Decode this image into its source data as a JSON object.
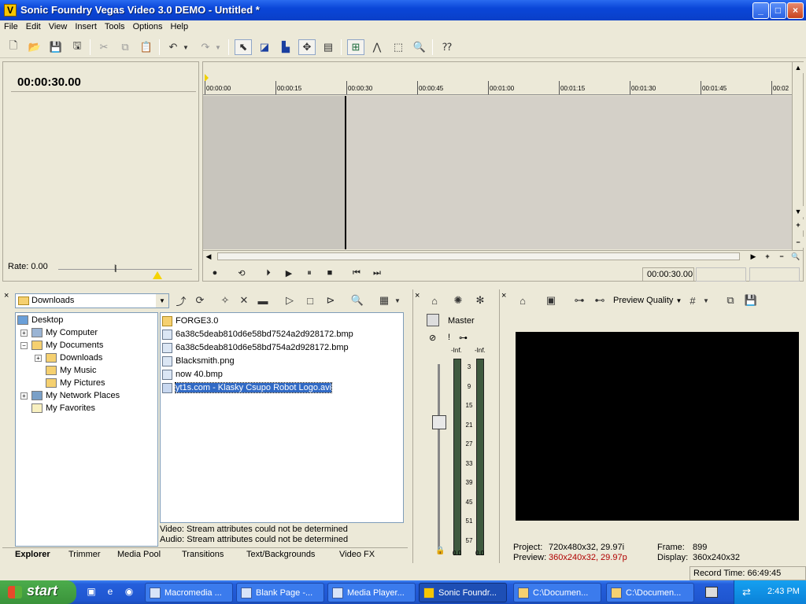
{
  "window": {
    "title": "Sonic Foundry Vegas Video 3.0 DEMO - Untitled *",
    "app_icon": "V",
    "controls": {
      "minimize": "_",
      "maximize": "□",
      "close": "×"
    }
  },
  "menu": [
    "File",
    "Edit",
    "View",
    "Insert",
    "Tools",
    "Options",
    "Help"
  ],
  "timeline": {
    "time_display": "00:00:30.00",
    "rate_label": "Rate: 0.00",
    "ruler_ticks": [
      "00:00:00",
      "00:00:15",
      "00:00:30",
      "00:00:45",
      "00:01:00",
      "00:01:15",
      "00:01:30",
      "00:01:45",
      "00:02"
    ],
    "transport_time": "00:00:30.00"
  },
  "explorer": {
    "current_folder": "Downloads",
    "tree": [
      {
        "label": "Desktop",
        "icon": "desktop-icon",
        "level": 0
      },
      {
        "label": "My Computer",
        "icon": "computer-icon",
        "level": 1,
        "expander": "+"
      },
      {
        "label": "My Documents",
        "icon": "folder-icon",
        "level": 1,
        "expander": "−"
      },
      {
        "label": "Downloads",
        "icon": "folder-icon",
        "level": 2,
        "expander": "+"
      },
      {
        "label": "My Music",
        "icon": "music-folder-icon",
        "level": 2
      },
      {
        "label": "My Pictures",
        "icon": "pictures-folder-icon",
        "level": 2
      },
      {
        "label": "My Network Places",
        "icon": "network-icon",
        "level": 1,
        "expander": "+"
      },
      {
        "label": "My Favorites",
        "icon": "favorites-icon",
        "level": 1
      }
    ],
    "files": [
      {
        "name": "FORGE3.0",
        "icon": "folder-icon"
      },
      {
        "name": "6a38c5deab810d6e58bd7524a2d928172.bmp",
        "icon": "image-file-icon"
      },
      {
        "name": "6a38c5deab810d6e58bd754a2d928172.bmp",
        "icon": "image-file-icon"
      },
      {
        "name": "Blacksmith.png",
        "icon": "image-file-icon"
      },
      {
        "name": "now 40.bmp",
        "icon": "image-file-icon"
      },
      {
        "name": "yt1s.com - Klasky Csupo Robot Logo.avi",
        "icon": "video-file-icon",
        "selected": true
      }
    ],
    "stream_video": "Video: Stream attributes could not be determined",
    "stream_audio": "Audio: Stream attributes could not be determined",
    "tabs": [
      "Explorer",
      "Trimmer",
      "Media Pool",
      "Transitions",
      "Text/Backgrounds",
      "Video FX"
    ],
    "active_tab": "Explorer"
  },
  "mixer": {
    "label": "Master",
    "inf_left": "-Inf.",
    "inf_right": "-Inf.",
    "db_scale": [
      "3",
      "9",
      "15",
      "21",
      "27",
      "33",
      "39",
      "45",
      "51",
      "57"
    ],
    "level_left": "0.0",
    "level_right": "0.0"
  },
  "preview": {
    "quality_label": "Preview Quality",
    "project_label": "Project:",
    "project_value": "720x480x32, 29.97i",
    "preview_label": "Preview:",
    "preview_value": "360x240x32, 29.97p",
    "frame_label": "Frame:",
    "frame_value": "899",
    "display_label": "Display:",
    "display_value": "360x240x32"
  },
  "status": {
    "record_time": "Record Time: 66:49:45"
  },
  "taskbar": {
    "start": "start",
    "tasks": [
      {
        "label": "Macromedia ..."
      },
      {
        "label": "Blank Page -..."
      },
      {
        "label": "Media Player..."
      },
      {
        "label": "Sonic Foundr...",
        "active": true
      },
      {
        "label": "C:\\Documen..."
      },
      {
        "label": "C:\\Documen..."
      }
    ],
    "clock": "2:43 PM"
  },
  "colors": {
    "accent": "#316ac5",
    "titlebar": "#0a46d8",
    "taskbar": "#245edb",
    "start": "#3a933a",
    "warning_red": "#b00000"
  }
}
